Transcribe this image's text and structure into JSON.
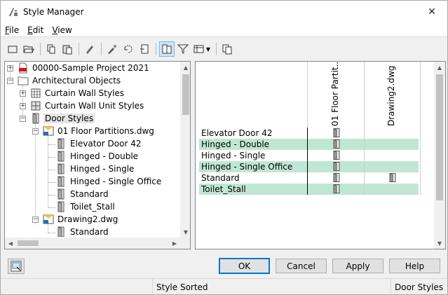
{
  "window": {
    "title": "Style Manager",
    "close_glyph": "✕"
  },
  "menu": [
    {
      "key": "F",
      "rest": "ile"
    },
    {
      "key": "E",
      "rest": "dit"
    },
    {
      "key": "V",
      "rest": "iew"
    }
  ],
  "toolbar": {
    "icons": [
      "new-drawing-icon",
      "open-drawing-icon",
      "copy-icon",
      "paste-icon",
      "edit-style-icon",
      "purge-icon",
      "toggle-view-icon",
      "set-from-icon",
      "inline-edit-icon",
      "filter-icon",
      "view-mode-icon",
      "help-icon"
    ]
  },
  "tree": {
    "nodes": [
      {
        "label": "00000-Sample Project 2021",
        "icon": "project-pdf-icon"
      },
      {
        "label": "Architectural Objects",
        "icon": "folder-icon"
      },
      {
        "label": "Curtain Wall Styles",
        "icon": "curtain-wall-icon"
      },
      {
        "label": "Curtain Wall Unit Styles",
        "icon": "curtain-wall-unit-icon"
      },
      {
        "label": "Door Styles",
        "icon": "door-icon"
      },
      {
        "label": "01 Floor Partitions.dwg",
        "icon": "drawing-icon"
      },
      {
        "label": "Elevator Door 42",
        "icon": "door-icon"
      },
      {
        "label": "Hinged - Double",
        "icon": "door-icon"
      },
      {
        "label": "Hinged - Single",
        "icon": "door-icon"
      },
      {
        "label": "Hinged - Single Office",
        "icon": "door-icon"
      },
      {
        "label": "Standard",
        "icon": "door-icon"
      },
      {
        "label": "Toilet_Stall",
        "icon": "door-icon"
      },
      {
        "label": "Drawing2.dwg",
        "icon": "drawing-icon"
      },
      {
        "label": "Standard",
        "icon": "door-icon"
      }
    ]
  },
  "grid": {
    "columns": [
      "01 Floor Partit...",
      "Drawing2.dwg"
    ],
    "rows": [
      {
        "name": "Elevator Door 42",
        "in": [
          true,
          false
        ]
      },
      {
        "name": "Hinged - Double",
        "in": [
          true,
          false
        ]
      },
      {
        "name": "Hinged - Single",
        "in": [
          true,
          false
        ]
      },
      {
        "name": "Hinged - Single Office",
        "in": [
          true,
          false
        ]
      },
      {
        "name": "Standard",
        "in": [
          true,
          true
        ]
      },
      {
        "name": "Toilet_Stall",
        "in": [
          true,
          false
        ]
      }
    ]
  },
  "buttons": {
    "ok": "OK",
    "cancel": "Cancel",
    "apply": "Apply",
    "help": "Help"
  },
  "status": {
    "left": "",
    "middle": "Style Sorted",
    "right": "Door Styles"
  },
  "colors": {
    "alt_row": "#c0e6d5",
    "selection": "#e5e5e5",
    "accent": "#0078d7"
  }
}
